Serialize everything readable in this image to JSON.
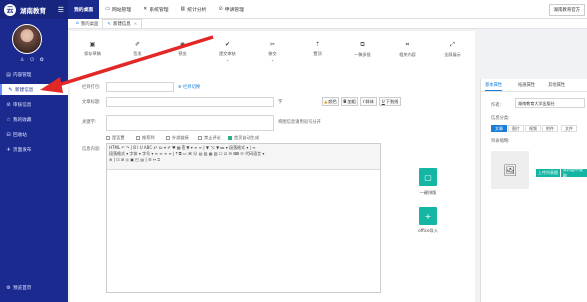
{
  "brand": {
    "name": "湖南教育",
    "logo_char": "云"
  },
  "user": {
    "icons": "♙ ⏻ ✿"
  },
  "sidebar": {
    "items": [
      {
        "label": "内容管理",
        "icon": "▤"
      },
      {
        "label": "新建信息",
        "icon": "✎"
      },
      {
        "label": "审核信息",
        "icon": "⊘"
      },
      {
        "label": "我的收藏",
        "icon": "☆"
      },
      {
        "label": "回收站",
        "icon": "⊟"
      },
      {
        "label": "页面发布",
        "icon": "✈"
      }
    ],
    "footer": "预览首页"
  },
  "topbar": {
    "items": [
      {
        "label": "我的桌面",
        "icon": ""
      },
      {
        "label": "网站管理",
        "icon": "▭"
      },
      {
        "label": "系统管理",
        "icon": "✕"
      },
      {
        "label": "统计分析",
        "icon": "▥"
      },
      {
        "label": "申请管理",
        "icon": "⊙"
      }
    ],
    "right_button": "湖南教育官方"
  },
  "tabs": [
    {
      "label": "我的桌面",
      "icon": "⌂"
    },
    {
      "label": "新建信息",
      "icon": "✎",
      "close": "×"
    }
  ],
  "toolbar": [
    {
      "label": "保存草稿",
      "icon": "▣"
    },
    {
      "label": "签发",
      "icon": "✐"
    },
    {
      "label": "预览",
      "icon": "◉"
    },
    {
      "label": "提交审核",
      "icon": "✔"
    },
    {
      "label": "移交",
      "icon": "✂"
    },
    {
      "label": "置顶",
      "icon": "⇡"
    },
    {
      "label": "一稿多投",
      "icon": "⧉"
    },
    {
      "label": "相关内容",
      "icon": "⌗"
    },
    {
      "label": "全屏展示",
      "icon": "⤢"
    }
  ],
  "form": {
    "column_label": "栏目打包:",
    "column_link": "栏目切换",
    "title_label": "文章标题:",
    "color_btn": "颜色",
    "bold_btn": "加粗",
    "italic_btn": "斜体",
    "underline_btn": "下划线",
    "char_hint": "字",
    "keyword_label": "关键字:",
    "keyword_placeholder": "将图片文件...",
    "keyword_hint": "将图信息请用逗号分开",
    "checkboxes": [
      {
        "label": "是否置",
        "checked": false
      },
      {
        "label": "推荐到",
        "checked": false
      },
      {
        "label": "外部链接",
        "checked": false
      },
      {
        "label": "禁止评论",
        "checked": false
      },
      {
        "label": "首页自动生成",
        "checked": true
      }
    ],
    "content_label": "信息内容:"
  },
  "editor": {
    "toolbar_rows": [
      "HTML ↶ ↷ | B I U ABC x² x₂ ⌖ ✐ ♥ ▦ ⎘ ▼ ▾ ≡ ≡ | ▼ ⌥ ▼ ▸▸ ▾ 段落格式 ▾ | ≡",
      "段落格式 ▾  字体 ▾  字号 ▾  ≡ ≡ ≡ ≡ | ⤒ ⧉ ▭ ⌘ ☺ ▤ ▥ ▦ ▧ ☐ ☑ ✉ ⌨ ☷ 代码语言 ▾",
      "⊕ | ⊡ ⊞ ◎ ▣ ◰ ▤ | ☰ ↔ ⌗"
    ]
  },
  "side_actions": [
    {
      "label": "一键排版",
      "icon": "▢"
    },
    {
      "label": "office导入",
      "icon": "+"
    }
  ],
  "right_panel": {
    "tabs": [
      "基本属性",
      "拓展属性",
      "其他属性"
    ],
    "author_label": "作者:",
    "author_value": "湖南教育大学出版社",
    "type_label": "信息分类:",
    "mini_tabs": [
      "文章",
      "图片",
      "视频",
      "附件",
      "文件"
    ],
    "image_label": "列表缩略:",
    "upload_btn": "上传列表图",
    "clear_btn": "从内容中获取"
  },
  "colors": {
    "sidebar": "#1b2a8e",
    "accent": "#13b5a3",
    "link": "#1b7ed6",
    "arrow": "#e32626"
  }
}
